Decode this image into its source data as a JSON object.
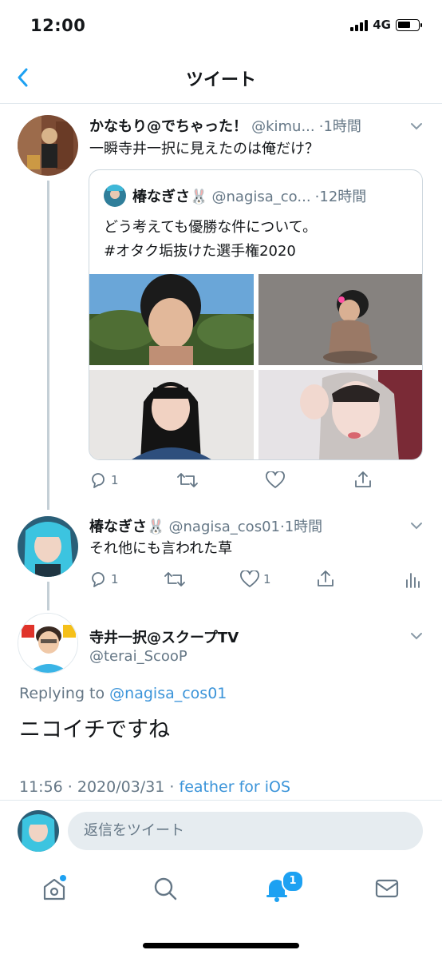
{
  "status_bar": {
    "time": "12:00",
    "network": "4G"
  },
  "nav": {
    "title": "ツイート"
  },
  "tweet1": {
    "name": "かなもり@でちゃった！",
    "handle": "@kimu...",
    "time": "·1時間",
    "text": "一瞬寺井一択に見えたのは俺だけ？",
    "quote": {
      "name": "椿なぎさ🐰",
      "handle": "@nagisa_co...",
      "time": "·12時間",
      "text_line1": "どう考えても優勝な件について。",
      "text_line2": "#オタク垢抜けた選手権2020"
    },
    "reply_count": "1"
  },
  "tweet2": {
    "name": "椿なぎさ🐰",
    "handle": "@nagisa_cos01",
    "time": "·1時間",
    "text": "それ他にも言われた草",
    "reply_count": "1",
    "like_count": "1"
  },
  "main_tweet": {
    "name": "寺井一択@スクープTV",
    "handle": "@terai_ScooP",
    "replying_prefix": "Replying to",
    "replying_to": "@nagisa_cos01",
    "text": "ニコイチですね",
    "timestamp": "11:56 · 2020/03/31 ·",
    "source": "feather for iOS"
  },
  "reply_bar": {
    "placeholder": "返信をツイート"
  },
  "tab_bar": {
    "notification_badge": "1"
  },
  "colors": {
    "accent": "#1da1f2",
    "link": "#3b94d9",
    "muted": "#657786"
  }
}
